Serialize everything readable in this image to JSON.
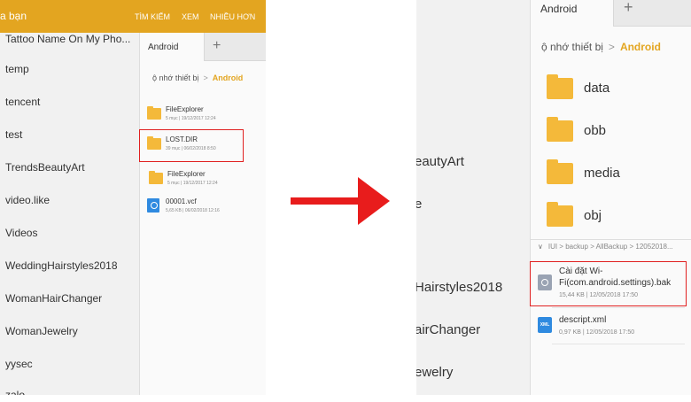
{
  "left": {
    "topbar": {
      "title": "a bạn",
      "actions": [
        "TÌM KIẾM",
        "XEM",
        "NHIỀU HƠN"
      ]
    },
    "list": [
      "Tattoo Name On My Pho...",
      "temp",
      "tencent",
      "test",
      "TrendsBeautyArt",
      "video.like",
      "Videos",
      "WeddingHairstyles2018",
      "WomanHairChanger",
      "WomanJewelry",
      "yysec",
      "zalo"
    ],
    "panel": {
      "tab_label": "Android",
      "plus": "+",
      "breadcrumb": {
        "root": "ộ nhớ thiết bị",
        "sep": ">",
        "current": "Android"
      },
      "items": [
        {
          "name": "FileExplorer",
          "meta": "5 mục  |  19/12/2017 12:24"
        },
        {
          "name": "LOST.DIR",
          "meta": "39 mục  |  06/02/2018 8:50"
        },
        {
          "name": "FileExplorer",
          "meta": "5 mục  |  19/12/2017 12:24"
        },
        {
          "name": "00001.vcf",
          "meta": "5,65 KB  |  06/02/2018 12:16"
        }
      ]
    }
  },
  "right": {
    "list": [
      "eautyArt",
      "e",
      "Hairstyles2018",
      "airChanger",
      "ewelry"
    ],
    "panel": {
      "tab_label": "Android",
      "plus": "+",
      "breadcrumb": {
        "root": "ộ nhớ thiết bị",
        "sep": ">",
        "current": "Android"
      },
      "folders": [
        "data",
        "obb",
        "media",
        "obj"
      ],
      "path": {
        "chevron": "∨",
        "text": "IUI > backup > AllBackup > 12052018..."
      },
      "files": [
        {
          "name": "Cài đặt Wi-Fi(com.android.settings).bak",
          "meta": "15,44 KB  |  12/05/2018 17:50"
        },
        {
          "name": "descript.xml",
          "meta": "0,97 KB  |  12/05/2018 17:50",
          "icon_text": "XML"
        }
      ]
    }
  },
  "colors": {
    "accent": "#e3a520",
    "highlight": "#e02020",
    "folder": "#f4b93a"
  },
  "icons": {
    "folder": "folder-icon",
    "arrow": "red-arrow-icon",
    "vcf": "contact-file-icon",
    "bak": "settings-file-icon",
    "xml": "xml-file-icon"
  }
}
